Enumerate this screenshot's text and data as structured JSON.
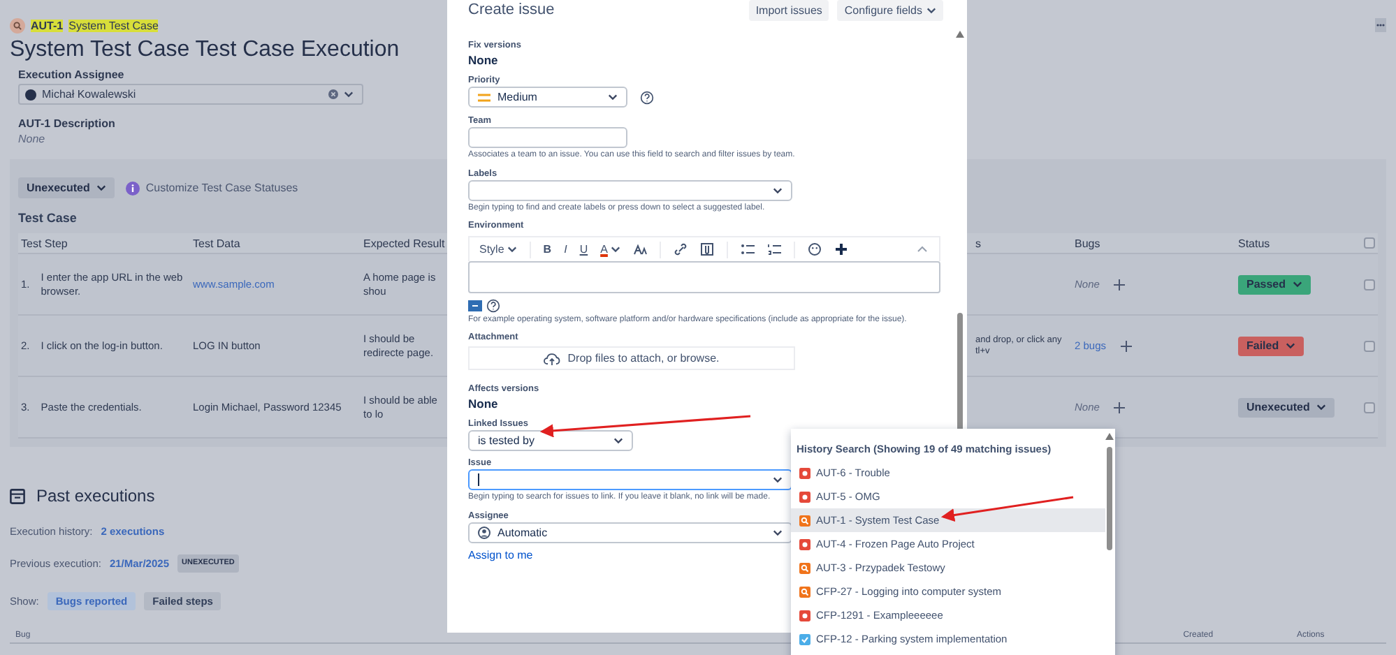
{
  "breadcrumb": {
    "key": "AUT-1",
    "title": "System Test Case"
  },
  "page_title": "System Test Case Test Case Execution",
  "assignee": {
    "label": "Execution Assignee",
    "value": "Michał Kowalewski"
  },
  "description": {
    "label": "AUT-1 Description",
    "value": "None"
  },
  "test_case": {
    "status_button": "Unexecuted",
    "customize_link": "Customize Test Case Statuses",
    "heading": "Test Case",
    "columns": [
      "Test Step",
      "Test Data",
      "Expected Result",
      "s",
      "Bugs",
      "Status"
    ],
    "header_checked": false,
    "rows": [
      {
        "number": "1.",
        "step": "I enter the app URL in the web browser.",
        "data": "www.sample.com",
        "data_link": true,
        "expected": "A home page is shou",
        "bugs": "None",
        "bugs_link": false,
        "status": "Passed",
        "color": "#3aa57a",
        "checked": false
      },
      {
        "number": "2.",
        "step": "I click on the log-in button.",
        "data": "LOG IN button",
        "data_link": false,
        "expected": "I should be redirecte page.",
        "actual": "and drop, or click any tl+v",
        "bugs": "2 bugs",
        "bugs_link": true,
        "status": "Failed",
        "color": "#c9605f",
        "checked": false
      },
      {
        "number": "3.",
        "step": "Paste the credentials.",
        "data": "Login Michael, Password 12345",
        "data_link": false,
        "expected": "I should be able to lo",
        "bugs": "None",
        "bugs_link": false,
        "status": "Unexecuted",
        "color": "#a9b0bd",
        "checked": false
      }
    ]
  },
  "past": {
    "heading": "Past executions",
    "history_label": "Execution history:",
    "history_link": "2 executions",
    "previous_label": "Previous execution:",
    "previous_date": "21/Mar/2025",
    "previous_status": "UNEXECUTED",
    "show_label": "Show:",
    "filters": [
      {
        "label": "Bugs reported",
        "selected": true
      },
      {
        "label": "Failed steps",
        "selected": false
      }
    ],
    "columns": [
      "Bug",
      "Created",
      "Actions"
    ]
  },
  "modal": {
    "title": "Create issue",
    "import_button": "Import issues",
    "configure_button": "Configure fields",
    "fix_versions": {
      "label": "Fix versions",
      "value": "None"
    },
    "priority": {
      "label": "Priority",
      "value": "Medium"
    },
    "team": {
      "label": "Team",
      "hint": "Associates a team to an issue. You can use this field to search and filter issues by team."
    },
    "labels": {
      "label": "Labels",
      "hint": "Begin typing to find and create labels or press down to select a suggested label."
    },
    "environment": {
      "label": "Environment",
      "toolbar": [
        "Style",
        "B",
        "I",
        "U",
        "A"
      ],
      "hint": "For example operating system, software platform and/or hardware specifications (include as appropriate for the issue)."
    },
    "attachment": {
      "label": "Attachment",
      "drop_text": "Drop files to attach, or browse."
    },
    "affects_versions": {
      "label": "Affects versions",
      "value": "None"
    },
    "linked_issues": {
      "label": "Linked Issues",
      "value": "is tested by"
    },
    "issue": {
      "label": "Issue",
      "hint": "Begin typing to search for issues to link. If you leave it blank, no link will be made."
    },
    "assignee": {
      "label": "Assignee",
      "value": "Automatic",
      "assign_link": "Assign to me"
    }
  },
  "dropdown": {
    "heading": "History Search (Showing 19 of 49 matching issues)",
    "items": [
      {
        "kind": "bug",
        "label": "AUT-6 - Trouble",
        "selected": false
      },
      {
        "kind": "bug",
        "label": "AUT-5 - OMG",
        "selected": false
      },
      {
        "kind": "test",
        "label": "AUT-1 - System Test Case",
        "selected": true
      },
      {
        "kind": "bug",
        "label": "AUT-4 - Frozen Page Auto Project",
        "selected": false
      },
      {
        "kind": "test",
        "label": "AUT-3 - Przypadek Testowy",
        "selected": false
      },
      {
        "kind": "test",
        "label": "CFP-27 - Logging into computer system",
        "selected": false
      },
      {
        "kind": "bug",
        "label": "CFP-1291 - Exampleeeeee",
        "selected": false
      },
      {
        "kind": "task",
        "label": "CFP-12 - Parking system implementation",
        "selected": false
      }
    ]
  }
}
